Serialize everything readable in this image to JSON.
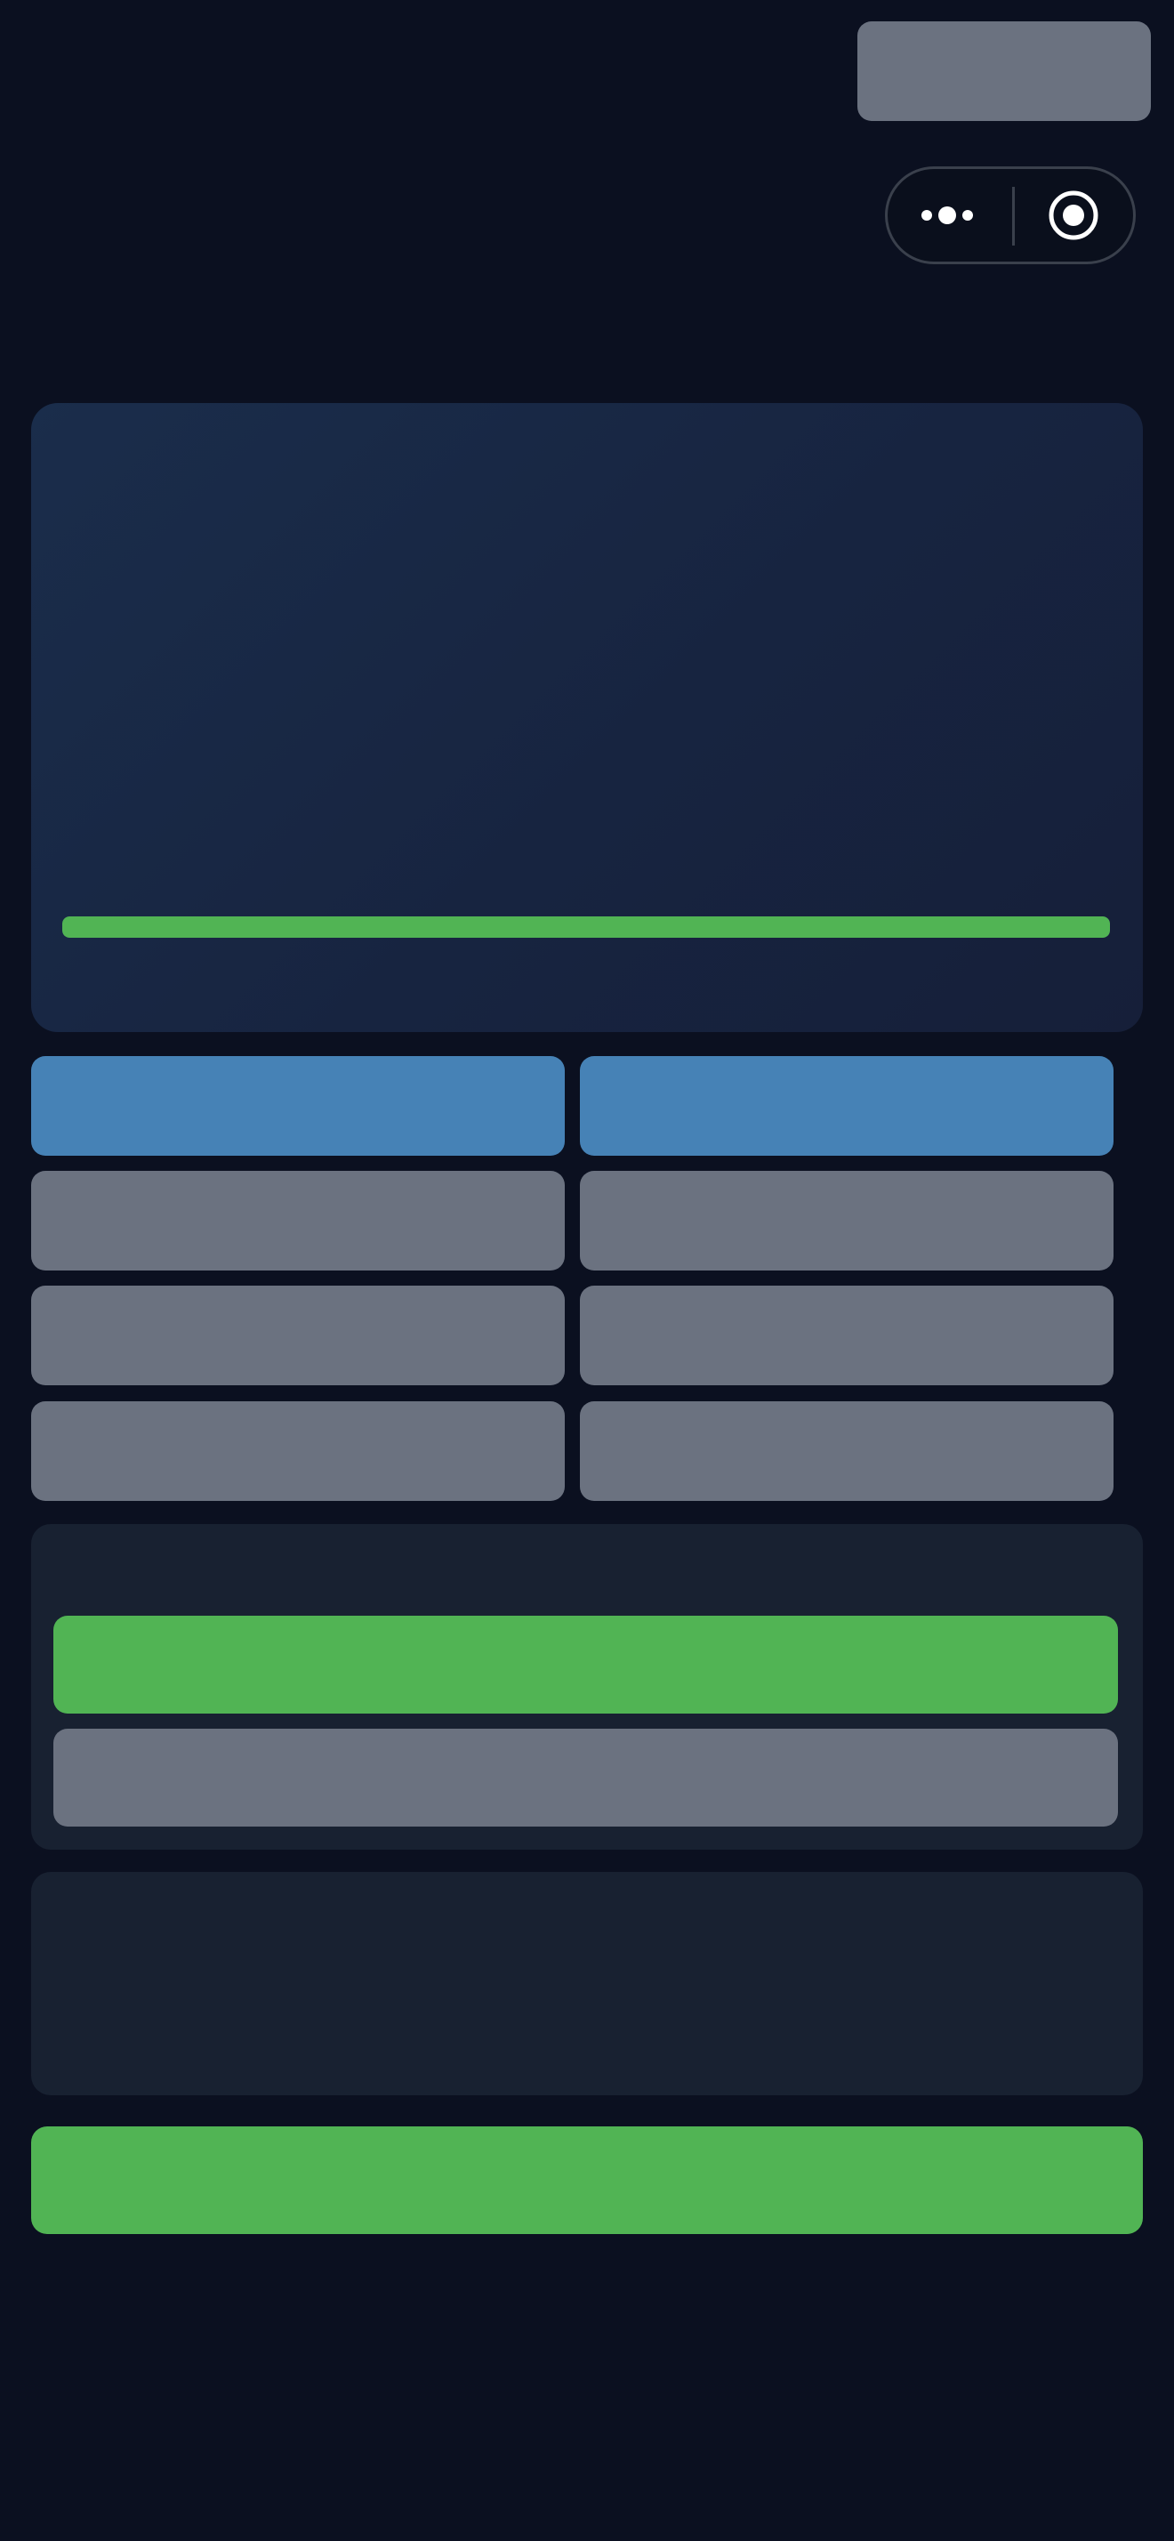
{
  "header": {
    "top_button_label": "",
    "capsule": {
      "more_icon": "more-dots-icon",
      "close_icon": "record-target-icon"
    }
  },
  "hero": {
    "title": "",
    "progress_fraction": 1.0
  },
  "options": [
    {
      "label": "",
      "style": "blue"
    },
    {
      "label": "",
      "style": "blue"
    },
    {
      "label": "",
      "style": "gray"
    },
    {
      "label": "",
      "style": "gray"
    },
    {
      "label": "",
      "style": "gray"
    },
    {
      "label": "",
      "style": "gray"
    },
    {
      "label": "",
      "style": "gray"
    },
    {
      "label": "",
      "style": "gray"
    }
  ],
  "action_panel": {
    "primary_label": "",
    "secondary_label": ""
  },
  "info_panel": {
    "text": ""
  },
  "footer": {
    "button_label": ""
  },
  "colors": {
    "background": "#0b1020",
    "accent_green": "#51b454",
    "accent_blue": "#4682b6",
    "neutral_gray": "#6b7280",
    "panel": "#182131"
  }
}
